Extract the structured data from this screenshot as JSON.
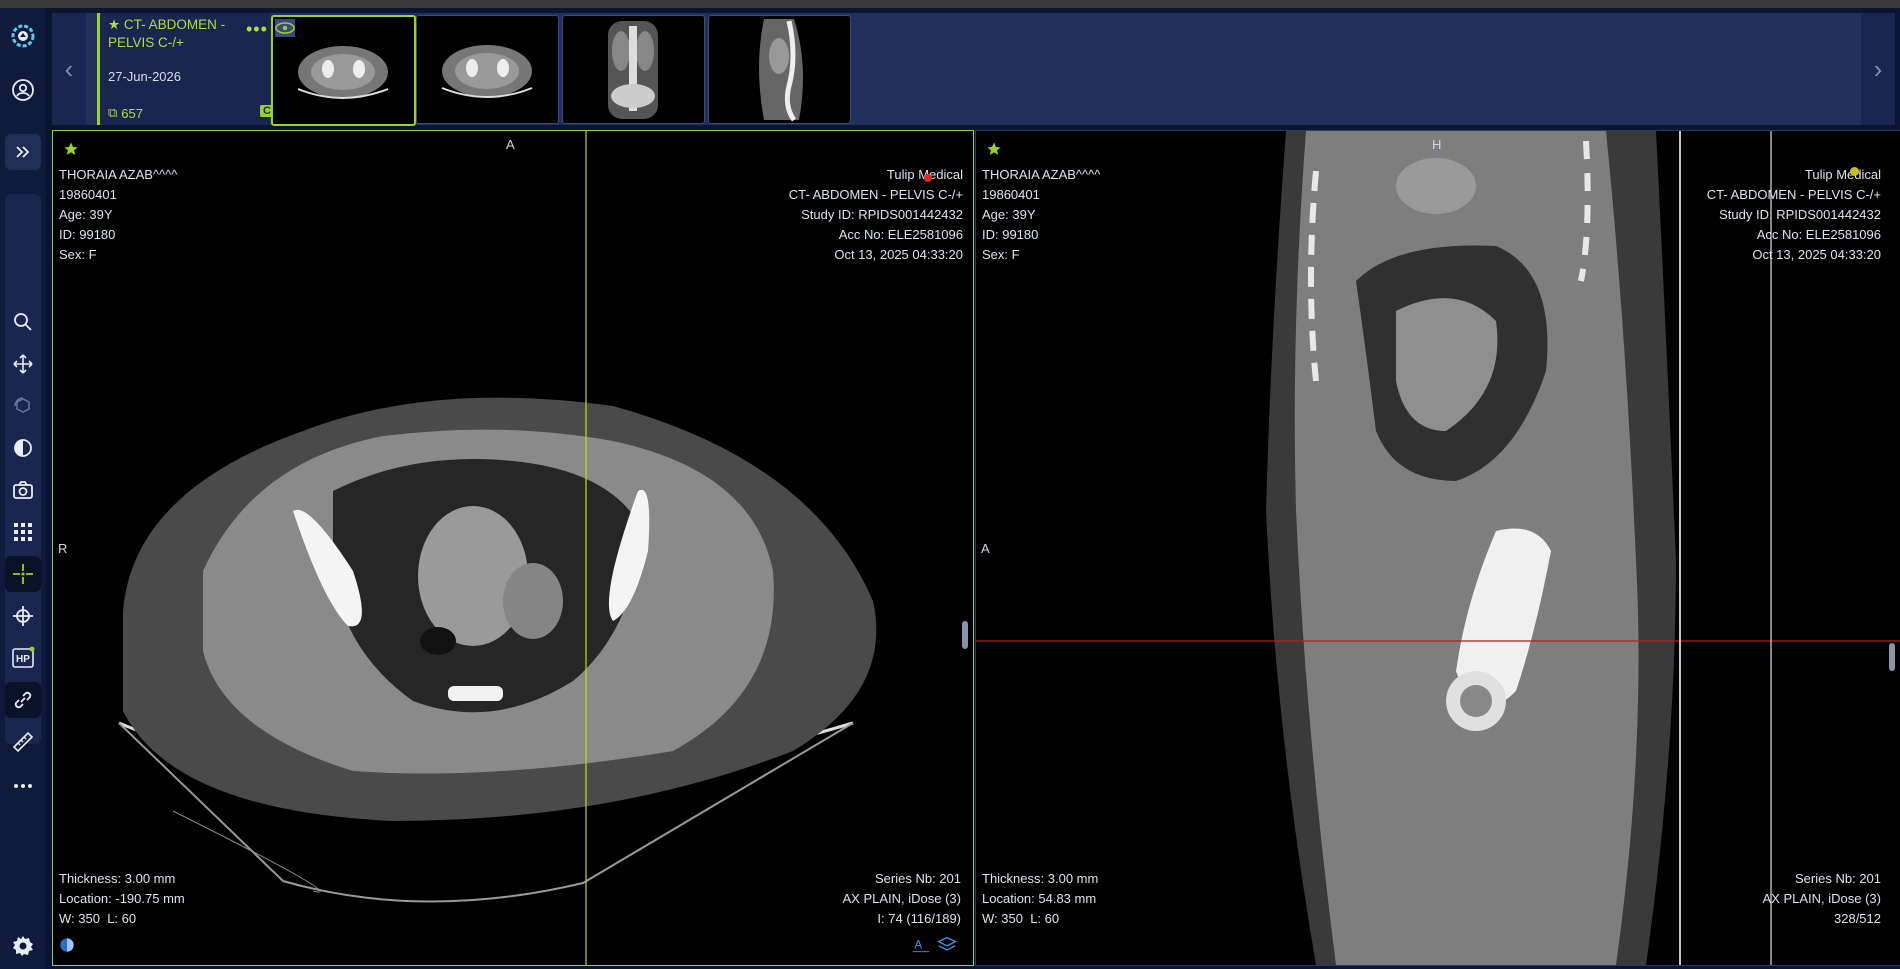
{
  "study": {
    "title": "CT- ABDOMEN - PELVIS C-/+",
    "date": "27-Jun-2026",
    "image_count": "657",
    "modality": "CT"
  },
  "nav": {
    "prev": "‹",
    "next": "›"
  },
  "thumbnails": [
    {
      "label": "axial-series-1"
    },
    {
      "label": "axial-series-2"
    },
    {
      "label": "coronal-series"
    },
    {
      "label": "sagittal-series"
    }
  ],
  "sidebar": {
    "tools": [
      "app-logo",
      "user-profile",
      "expand-panel",
      "zoom",
      "pan",
      "rotate-3d",
      "window-level",
      "screenshot",
      "layout-grid",
      "crosshair",
      "reference-lines",
      "hanging-protocol",
      "link-sync",
      "measure-ruler",
      "more-tools",
      "settings"
    ]
  },
  "viewports": [
    {
      "patient_name": "THORAIA AZAB^^^^",
      "dob": "19860401",
      "age": "Age: 39Y",
      "id": "ID: 99180",
      "sex": "Sex: F",
      "institution": "Tulip Medical",
      "study_desc": "CT- ABDOMEN - PELVIS C-/+",
      "study_id": "Study ID: RPIDS001442432",
      "acc_no": "Acc No: ELE2581096",
      "datetime": "Oct 13, 2025 04:33:20",
      "thickness": "Thickness: 3.00 mm",
      "location": "Location: -190.75 mm",
      "window": "W: 350",
      "level": "L: 60",
      "series_nb": "Series Nb: 201",
      "series_desc": "AX PLAIN, iDose (3)",
      "image_index": "I: 74 (116/189)",
      "orient_top": "A",
      "orient_left": "R"
    },
    {
      "patient_name": "THORAIA AZAB^^^^",
      "dob": "19860401",
      "age": "Age: 39Y",
      "id": "ID: 99180",
      "sex": "Sex: F",
      "institution": "Tulip Medical",
      "study_desc": "CT- ABDOMEN - PELVIS C-/+",
      "study_id": "Study ID: RPIDS001442432",
      "acc_no": "Acc No: ELE2581096",
      "datetime": "Oct 13, 2025 04:33:20",
      "thickness": "Thickness: 3.00 mm",
      "location": "Location: 54.83 mm",
      "window": "W: 350",
      "level": "L: 60",
      "series_nb": "Series Nb: 201",
      "series_desc": "AX PLAIN, iDose (3)",
      "image_index": "328/512",
      "orient_top": "H",
      "orient_left": "A"
    }
  ],
  "colors": {
    "accent": "#9bd12b",
    "background": "#0b1430",
    "panel": "#22305e",
    "crosshair_vertical": "#c8d42a",
    "crosshair_horizontal": "#b0201a"
  }
}
